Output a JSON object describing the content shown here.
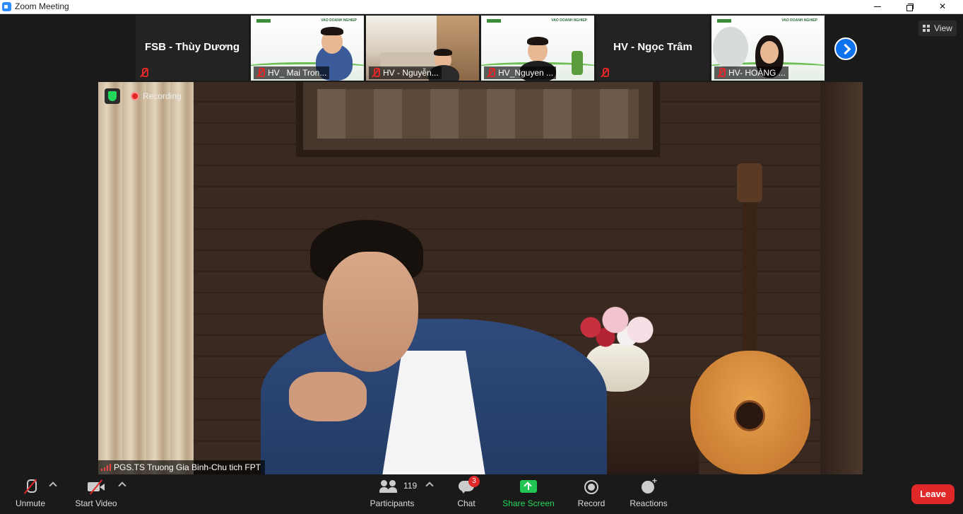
{
  "window": {
    "title": "Zoom Meeting",
    "minimize_icon": "minimize-icon",
    "maximize_icon": "restore-icon",
    "close_icon": "close-icon"
  },
  "view_button": {
    "label": "View",
    "icon": "grid-icon"
  },
  "thumbnails": [
    {
      "name": "FSB - Thùy Dương",
      "video": false,
      "muted": true
    },
    {
      "name": "HV_ Mai Tron...",
      "video": true,
      "muted": true
    },
    {
      "name": "HV - Nguyễn...",
      "video": true,
      "muted": true
    },
    {
      "name": "HV_Nguyen ...",
      "video": true,
      "muted": true
    },
    {
      "name": "HV - Ngọc Trâm",
      "video": false,
      "muted": true
    },
    {
      "name": "HV- HOÀNG ...",
      "video": true,
      "muted": true
    }
  ],
  "main_video": {
    "recording_label": "Recording",
    "speaker_name": "PGS.TS Truong Gia Binh-Chu tich FPT"
  },
  "toolbar": {
    "unmute": "Unmute",
    "start_video": "Start Video",
    "participants": "Participants",
    "participant_count": "119",
    "chat": "Chat",
    "chat_badge": "3",
    "share_screen": "Share Screen",
    "record": "Record",
    "reactions": "Reactions",
    "leave": "Leave"
  },
  "colors": {
    "accent_blue": "#0e72ed",
    "share_green": "#23c552",
    "leave_red": "#e02828",
    "background": "#1a1a1a"
  }
}
